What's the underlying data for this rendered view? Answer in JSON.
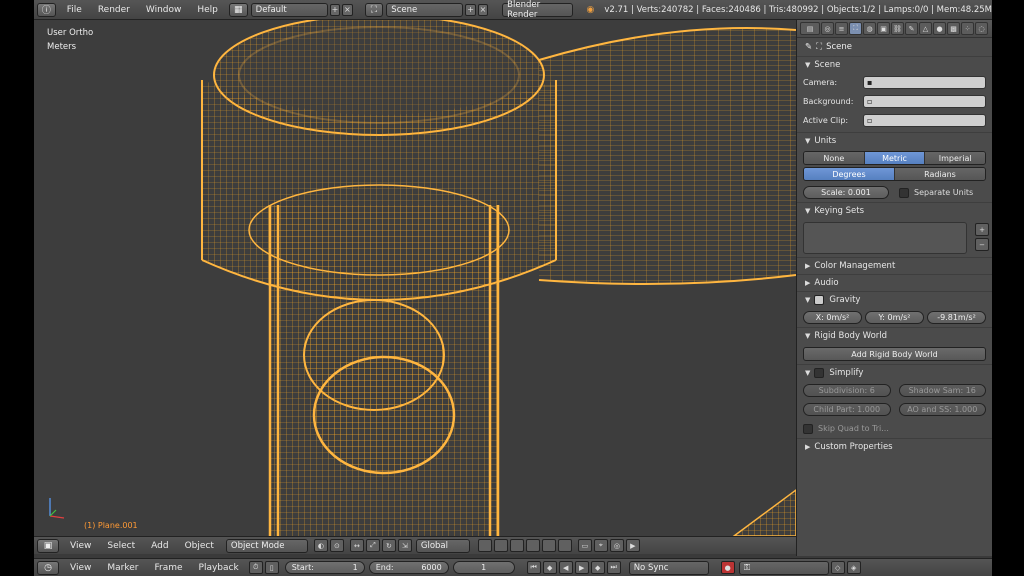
{
  "header": {
    "menus": [
      "File",
      "Render",
      "Window",
      "Help"
    ],
    "screen_layout": "Default",
    "scene": "Scene",
    "engine": "Blender Render",
    "stats": "v2.71 | Verts:240782 | Faces:240486 | Tris:480992 | Objects:1/2 | Lamps:0/0 | Mem:48.25M"
  },
  "viewport": {
    "view_name": "User Ortho",
    "units": "Meters",
    "object_label": "(1) Plane.001"
  },
  "properties": {
    "breadcrumb": "Scene",
    "scene_panel": {
      "title": "Scene",
      "camera_label": "Camera:",
      "background_label": "Background:",
      "active_clip_label": "Active Clip:"
    },
    "units_panel": {
      "title": "Units",
      "systems": [
        "None",
        "Metric",
        "Imperial"
      ],
      "selected_system": "Metric",
      "rotation": [
        "Degrees",
        "Radians"
      ],
      "selected_rotation": "Degrees",
      "scale": "Scale:        0.001",
      "separate_units": "Separate Units"
    },
    "keying_sets": "Keying Sets",
    "color_management": "Color Management",
    "audio": "Audio",
    "gravity": {
      "title": "Gravity",
      "x": "X:    0m/s²",
      "y": "Y:    0m/s²",
      "z": "-9.81m/s²"
    },
    "rigid_body": {
      "title": "Rigid Body World",
      "button": "Add Rigid Body World"
    },
    "simplify": {
      "title": "Simplify",
      "subdivision": "Subdivision:     6",
      "shadow_samples": "Shadow Sam:   16",
      "child_particles": "Child Part:  1.000",
      "ao_sss": "AO and SS:  1.000",
      "skip_quad": "Skip Quad to Tri..."
    },
    "custom_properties": "Custom Properties"
  },
  "view3d_header": {
    "menus": [
      "View",
      "Select",
      "Add",
      "Object"
    ],
    "mode": "Object Mode",
    "orientation": "Global"
  },
  "timeline": {
    "menus": [
      "View",
      "Marker",
      "Frame",
      "Playback"
    ],
    "start": "Start:",
    "start_value": "1",
    "end": "End:",
    "end_value": "6000",
    "current": "1",
    "sync": "No Sync"
  },
  "colors": {
    "wire": "#f5a623",
    "background": "#3d3d3d",
    "accent": "#5680c0"
  }
}
